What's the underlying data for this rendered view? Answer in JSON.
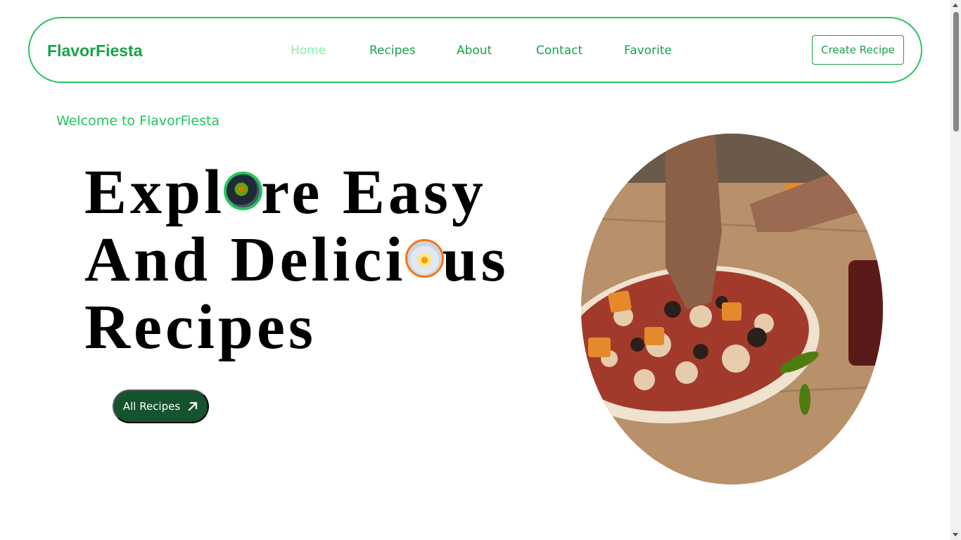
{
  "navbar": {
    "brand": "FlavorFiesta",
    "links": [
      {
        "label": "Home",
        "active": true
      },
      {
        "label": "Recipes",
        "active": false
      },
      {
        "label": "About",
        "active": false
      },
      {
        "label": "Contact",
        "active": false
      },
      {
        "label": "Favorite",
        "active": false
      }
    ],
    "create_button": "Create Recipe"
  },
  "hero": {
    "welcome": "Welcome to FlavorFiesta",
    "headline": {
      "line1_before": "Expl",
      "line1_after": "re Easy",
      "line2_before": "And Delici",
      "line2_after": "us",
      "line3": "Recipes"
    },
    "cta_label": "All Recipes",
    "cta_icon": "arrow-up-right-icon",
    "image": "pizza-preparation-photo"
  },
  "colors": {
    "accent": "#22c55e",
    "accent_dark": "#16a34a",
    "nav_active": "#86efac",
    "cta_bg": "#14532d",
    "orange_ring": "#f97316"
  }
}
